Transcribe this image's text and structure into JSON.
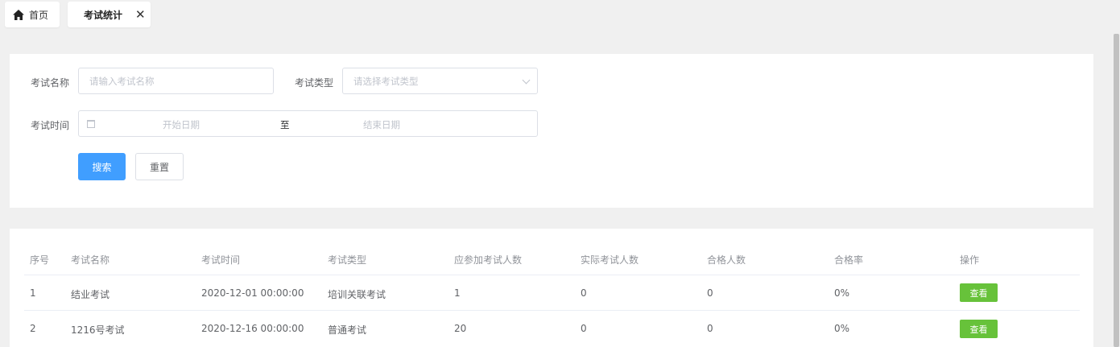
{
  "tabs": {
    "home_label": "首页",
    "active_label": "考试统计",
    "close_symbol": "✕"
  },
  "search": {
    "name_label": "考试名称",
    "name_placeholder": "请输入考试名称",
    "type_label": "考试类型",
    "type_placeholder": "请选择考试类型",
    "time_label": "考试时间",
    "start_placeholder": "开始日期",
    "range_separator": "至",
    "end_placeholder": "结束日期",
    "search_button": "搜索",
    "reset_button": "重置"
  },
  "table": {
    "columns": [
      "序号",
      "考试名称",
      "考试时间",
      "考试类型",
      "应参加考试人数",
      "实际考试人数",
      "合格人数",
      "合格率",
      "操作"
    ],
    "rows": [
      {
        "index": "1",
        "name": "结业考试",
        "time": "2020-12-01 00:00:00",
        "type": "培训关联考试",
        "expected": "1",
        "actual": "0",
        "passed": "0",
        "rate": "0%",
        "action": "查看"
      },
      {
        "index": "2",
        "name": "1216号考试",
        "time": "2020-12-16 00:00:00",
        "type": "普通考试",
        "expected": "20",
        "actual": "0",
        "passed": "0",
        "rate": "0%",
        "action": "查看"
      }
    ]
  },
  "colors": {
    "primary": "#409eff",
    "success": "#67c23a",
    "background": "#f0f0f0"
  }
}
